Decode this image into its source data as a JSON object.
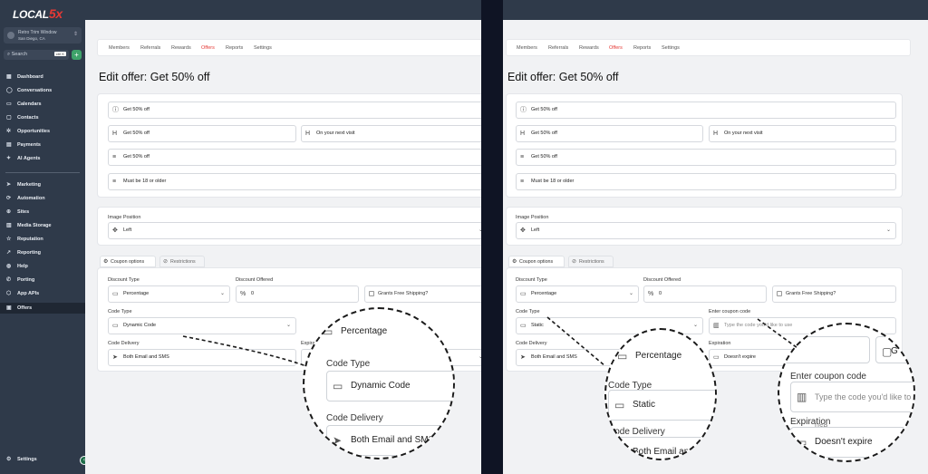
{
  "sidebar": {
    "logo_text": "LOCAL",
    "logo_accent": "5x",
    "location_name": "Retro Trim Window",
    "location_sub": "San Diego, CA",
    "search_placeholder": "Search",
    "search_shortcut": "ctrl K",
    "plus_label": "+",
    "items_top": [
      "Dashboard",
      "Conversations",
      "Calendars",
      "Contacts",
      "Opportunities",
      "Payments",
      "AI Agents"
    ],
    "items_bottom": [
      "Marketing",
      "Automation",
      "Sites",
      "Media Storage",
      "Reputation",
      "Reporting",
      "Help",
      "Porting",
      "App APIs",
      "Offers"
    ],
    "active_item": "Offers",
    "settings_label": "Settings",
    "collapse_label": "‹"
  },
  "tabs": [
    "Members",
    "Referrals",
    "Rewards",
    "Offers",
    "Reports",
    "Settings"
  ],
  "active_tab": "Offers",
  "page_title": "Edit offer: Get 50% off",
  "offer_fields": {
    "headline": "Get 50% off",
    "heading_left": "Get 50% off",
    "heading_right": "On your next visit",
    "description": "Get 50% off",
    "terms": "Must be 18 or older"
  },
  "image_position": {
    "label": "Image Position",
    "value": "Left"
  },
  "coupon_tabs": [
    "Coupon options",
    "Restrictions"
  ],
  "coupon": {
    "discount_type_label": "Discount Type",
    "discount_type_value": "Percentage",
    "discount_offered_label": "Discount Offered",
    "discount_offered_value": "0",
    "free_shipping_label": "Grants Free Shipping?",
    "code_type_label": "Code Type",
    "code_delivery_label": "Code Delivery",
    "code_delivery_value": "Both Email and SMS",
    "expiration_label": "Expiration",
    "expiration_value": "Doesn't expire",
    "enter_code_label": "Enter coupon code",
    "enter_code_placeholder": "Type the code you'd like to use"
  },
  "left_variant": {
    "code_type_value": "Dynamic Code",
    "expiration_label_partial": "Expirat",
    "zoom": {
      "top_value": "Percentage",
      "label1": "Code Type",
      "value1": "Dynamic Code",
      "label2": "Code Delivery",
      "value2": "Both Email and SMS"
    }
  },
  "right_variant": {
    "code_type_value": "Static",
    "zoom_left": {
      "top_value": "Percentage",
      "label1": "Code Type",
      "value1": "Static",
      "label2": "Code Delivery",
      "value2": "Both Email and S"
    },
    "zoom_right": {
      "g_partial": "G",
      "label1": "Enter coupon code",
      "placeholder": "Type the code you'd like to use",
      "label2": "Expiration",
      "value2": "Doesn't expire"
    }
  },
  "colors": {
    "sidebar_bg": "#2f3a4a",
    "accent_red": "#e53935",
    "separator": "#0f1424"
  }
}
